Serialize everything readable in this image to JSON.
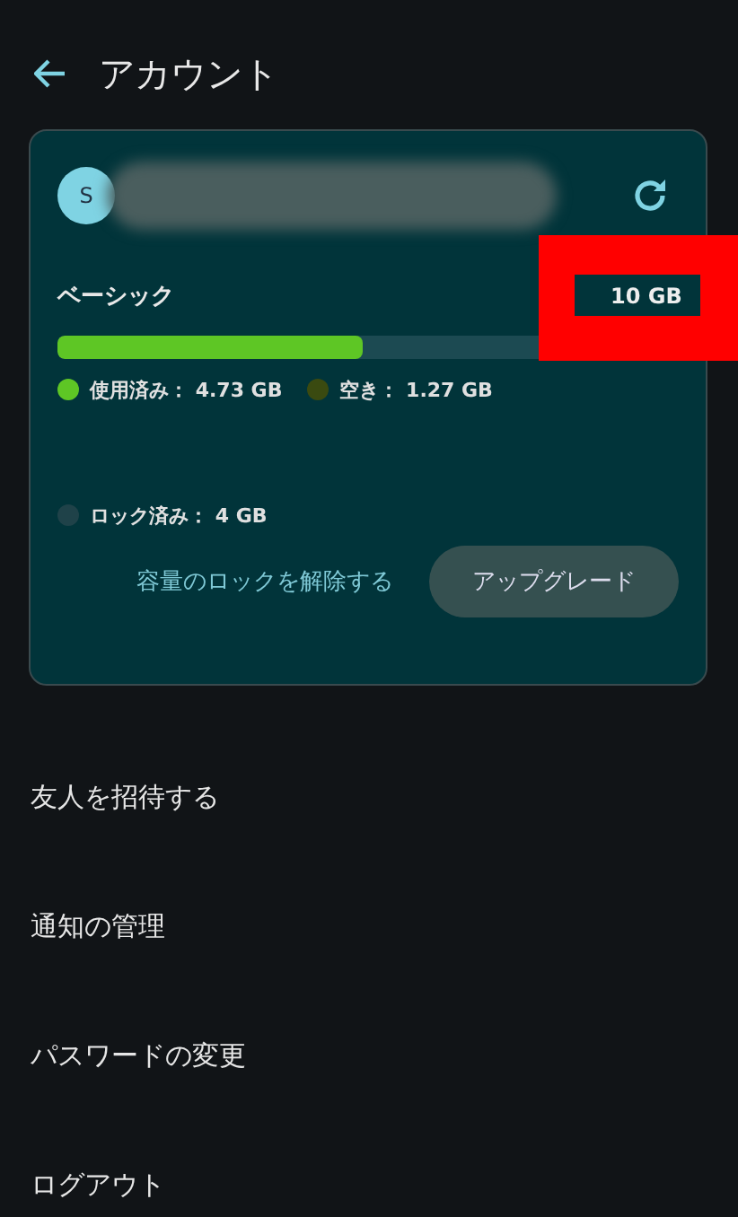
{
  "header": {
    "title": "アカウント"
  },
  "account": {
    "avatar_initial": "S",
    "plan": "ベーシック",
    "capacity": "10 GB",
    "usage": {
      "level": 0.49
    },
    "legend": [
      {
        "label": "使用済み： 4.73 GB",
        "color": "#5ec625"
      },
      {
        "label": "空き： 1.27 GB",
        "color": "#3a4a10"
      },
      {
        "label": "ロック済み： 4 GB",
        "color": "#1f4249"
      }
    ],
    "unlock_link": "容量のロックを解除する",
    "upgrade_button": "アップグレード"
  },
  "menu": [
    {
      "label": "友人を招待する"
    },
    {
      "label": "通知の管理"
    },
    {
      "label": "パスワードの変更"
    },
    {
      "label": "ログアウト"
    }
  ]
}
